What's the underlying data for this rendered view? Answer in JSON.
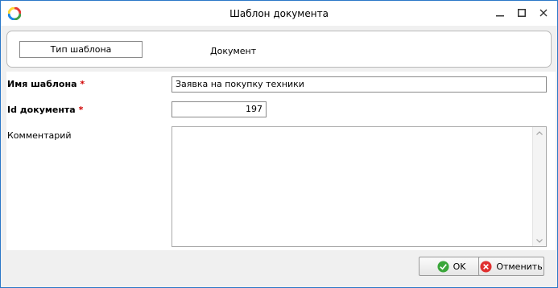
{
  "window": {
    "title": "Шаблон документа",
    "controls": {
      "minimize": "minimize-icon",
      "maximize": "maximize-icon",
      "close": "close-icon"
    }
  },
  "header": {
    "type_button_label": "Тип шаблона",
    "type_value": "Документ"
  },
  "form": {
    "name_label": "Имя шаблона",
    "name_value": "Заявка на покупку техники",
    "id_label": "Id документа",
    "id_value": "197",
    "comment_label": "Комментарий",
    "comment_value": "",
    "required_marker": "*"
  },
  "footer": {
    "ok_label": "OK",
    "cancel_label": "Отменить"
  },
  "colors": {
    "window_border": "#2b78c8",
    "required": "#d00000",
    "ok_icon": "#3aa63a",
    "cancel_icon": "#e03030"
  }
}
